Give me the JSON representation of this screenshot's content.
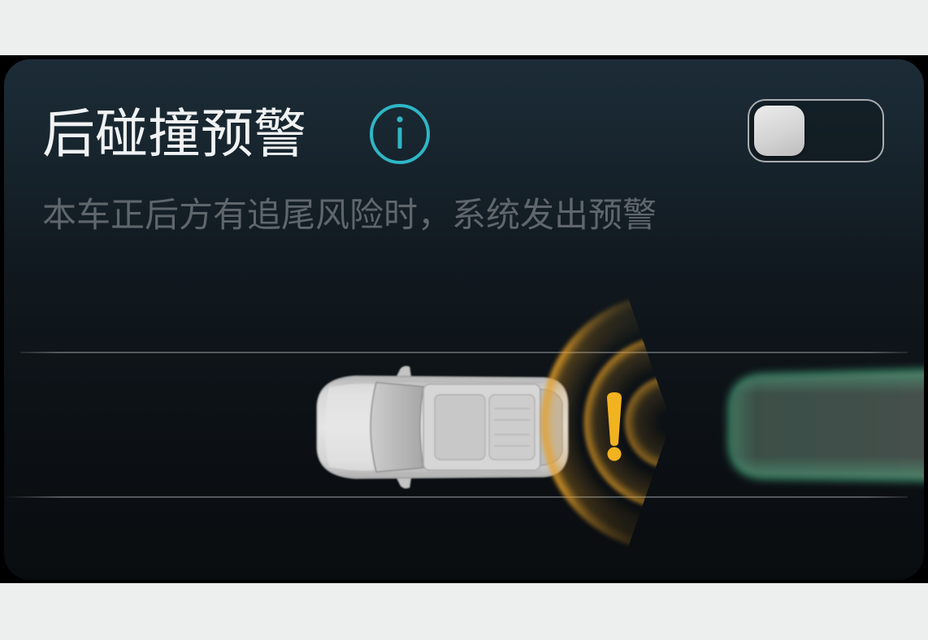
{
  "feature": {
    "title": "后碰撞预警",
    "description": "本车正后方有追尾风险时，系统发出预警",
    "info_icon": "info-icon",
    "toggle": {
      "on": false
    }
  },
  "illustration": {
    "ego_vehicle_icon": "ego-car-icon",
    "rear_vehicle_icon": "rear-car-icon",
    "warning_icon": "warning-exclamation-icon",
    "colors": {
      "accent": "#2fb6c6",
      "warning": "#f2b320",
      "alert_wave": "#e6a028",
      "rear_vehicle_glow": "#56bf8e"
    }
  }
}
